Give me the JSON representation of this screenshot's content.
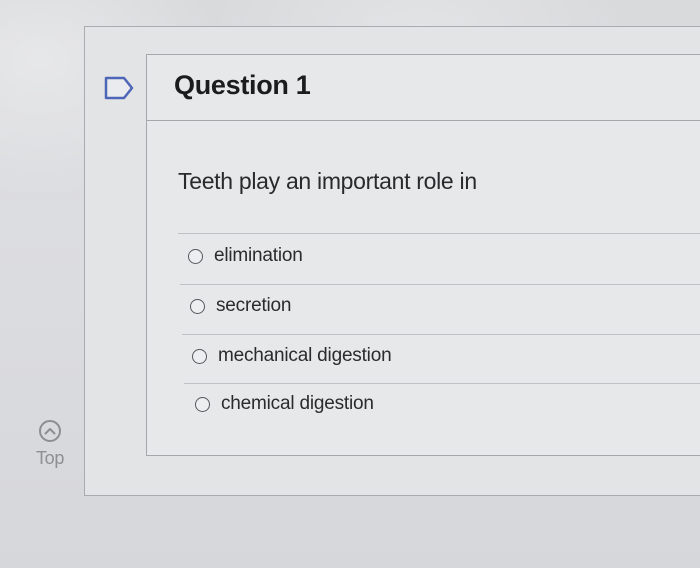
{
  "question": {
    "title": "Question 1",
    "text": "Teeth play an important role in",
    "options": [
      {
        "label": "elimination",
        "selected": false
      },
      {
        "label": "secretion",
        "selected": false
      },
      {
        "label": "mechanical digestion",
        "selected": false
      },
      {
        "label": "chemical digestion",
        "selected": false
      }
    ]
  },
  "navigation": {
    "top_label": "Top",
    "top_icon": "chevron-up-circle-icon",
    "flag_icon": "flag-question-icon"
  },
  "colors": {
    "text": "#2b2b2d",
    "border": "#a4a6a9",
    "muted": "#8d8f93"
  }
}
